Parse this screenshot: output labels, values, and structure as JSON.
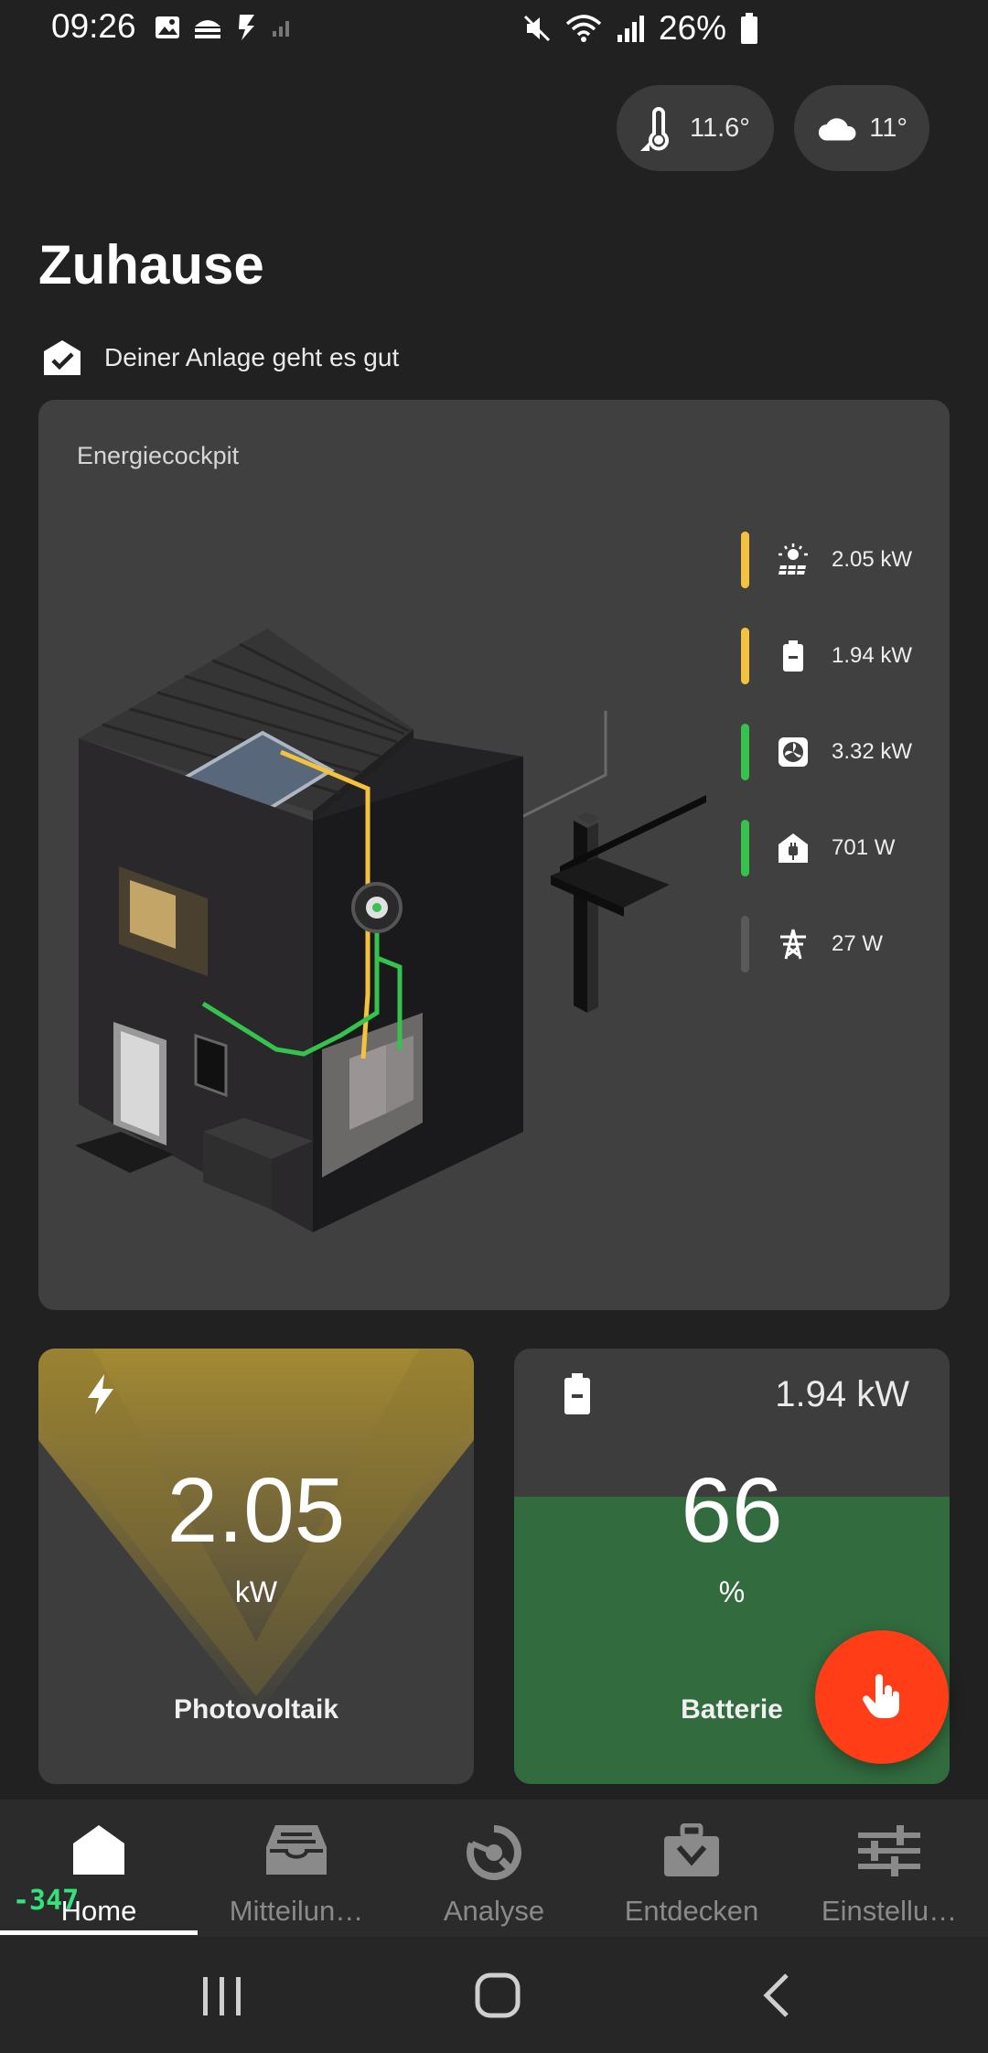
{
  "status_bar": {
    "time": "09:26",
    "battery_percent": "26%",
    "icons_left": [
      "image-icon",
      "gallery-icon",
      "app-s-icon",
      "signal-small-icon"
    ],
    "icons_right": [
      "mute-icon",
      "wifi-icon",
      "signal-icon",
      "battery-icon"
    ]
  },
  "weather": {
    "indoor_temp": "11.6°",
    "outdoor_temp": "11°"
  },
  "header": {
    "title": "Zuhause",
    "status_text": "Deiner Anlage geht es gut"
  },
  "cockpit": {
    "title": "Energiecockpit",
    "legend": [
      {
        "icon": "solar-icon",
        "value": "2.05",
        "unit": "kW",
        "color": "#f4c23d"
      },
      {
        "icon": "battery-icon",
        "value": "1.94",
        "unit": "kW",
        "color": "#f4c23d"
      },
      {
        "icon": "fan-icon",
        "value": "3.32",
        "unit": "kW",
        "color": "#35c24d"
      },
      {
        "icon": "house-plug-icon",
        "value": "701",
        "unit": "W",
        "color": "#35c24d"
      },
      {
        "icon": "grid-pylon-icon",
        "value": "27",
        "unit": "W",
        "color": "#5a5a5a"
      }
    ]
  },
  "tiles": {
    "pv": {
      "value": "2.05",
      "unit": "kW",
      "label": "Photovoltaik",
      "icon": "lightning-icon"
    },
    "battery": {
      "power": "1.94 kW",
      "value": "66",
      "unit": "%",
      "label": "Batterie",
      "icon": "battery-icon",
      "level": 0.66
    }
  },
  "fab": {
    "icon": "hand-pointer-icon"
  },
  "bottom_nav": {
    "items": [
      {
        "label": "Home",
        "icon": "home-icon",
        "active": true
      },
      {
        "label": "Mitteilun…",
        "icon": "inbox-icon",
        "active": false
      },
      {
        "label": "Analyse",
        "icon": "analyse-icon",
        "active": false
      },
      {
        "label": "Entdecken",
        "icon": "briefcase-icon",
        "active": false
      },
      {
        "label": "Einstellu…",
        "icon": "sliders-icon",
        "active": false
      }
    ]
  },
  "debug_overlay": "-347",
  "colors": {
    "background": "#212121",
    "card": "#404040",
    "yellow": "#f4c23d",
    "green": "#35c24d",
    "fab": "#ff3d17"
  }
}
